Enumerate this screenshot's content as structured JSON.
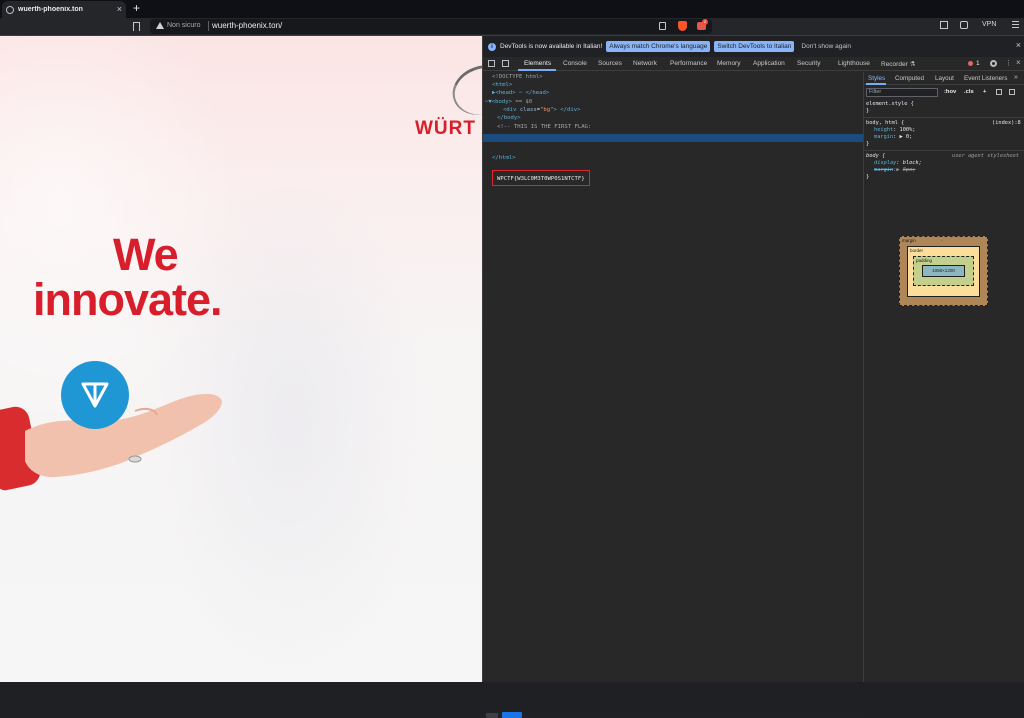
{
  "browser": {
    "tab_title": "wuerth-phoenix.ton",
    "tab_close": "×",
    "new_tab": "+",
    "security_label": "Non sicuro",
    "url": "wuerth-phoenix.ton/",
    "rewards_badge": "2",
    "vpn_label": "VPN"
  },
  "page": {
    "logo_text": "WÜRT",
    "headline_line1": "We",
    "headline_line2": "innovate."
  },
  "devtools": {
    "infobar": {
      "message": "DevTools is now available in Italian!",
      "button_match": "Always match Chrome's language",
      "button_switch": "Switch DevTools to Italian",
      "link_dismiss": "Don't show again",
      "close": "×"
    },
    "tabs": [
      "Elements",
      "Console",
      "Sources",
      "Network",
      "Performance",
      "Memory",
      "Application",
      "Security",
      "Lighthouse",
      "Recorder ⚗"
    ],
    "error_count": "1",
    "elements": {
      "doctype": "<!DOCTYPE html>",
      "html_open": "<html>",
      "head": "▶<head> ⋯ </head>",
      "body_open_tag": "▼<body>",
      "body_selected_marker": "== $0",
      "div_line_prefix": "<div ",
      "div_attr": "class",
      "div_val": "\"bg\"",
      "div_line_suffix": "> </div>",
      "body_close": "</body>",
      "comment": "<!-- THIS IS THE FIRST FLAG:",
      "flag": "WPCTF{W3LC0M3T0WP0S1NTCTF}",
      "html_close": "</html>",
      "crumb_active": "body"
    },
    "styles": {
      "tabs": [
        "Styles",
        "Computed",
        "Layout",
        "Event Listeners"
      ],
      "filter_placeholder": "Filter",
      "hov": ":hov",
      "cls": ".cls",
      "plus": "+",
      "rule1_selector": "element.style {",
      "rule1_close": "}",
      "rule2_selector": "body, html {",
      "rule2_source": "(index):8",
      "rule2_prop1": "height",
      "rule2_val1": "100%;",
      "rule2_prop2": "margin",
      "rule2_val2": "▶ 0;",
      "rule2_close": "}",
      "rule3_selector": "body {",
      "rule3_source": "user agent stylesheet",
      "rule3_prop1": "display",
      "rule3_val1": "block;",
      "rule3_prop2": "margin",
      "rule3_val2": "8px;",
      "rule3_close": "}",
      "box_margin": "margin",
      "box_border": "border",
      "box_padding": "padding",
      "box_content": "1056×1200",
      "box_dash": "-"
    }
  },
  "colors": {
    "brand_red": "#d81e2a",
    "ton_blue": "#1f97d4",
    "devtools_bg": "#282828",
    "selection_blue": "#1c4b7d",
    "flag_border": "#e0242b"
  }
}
